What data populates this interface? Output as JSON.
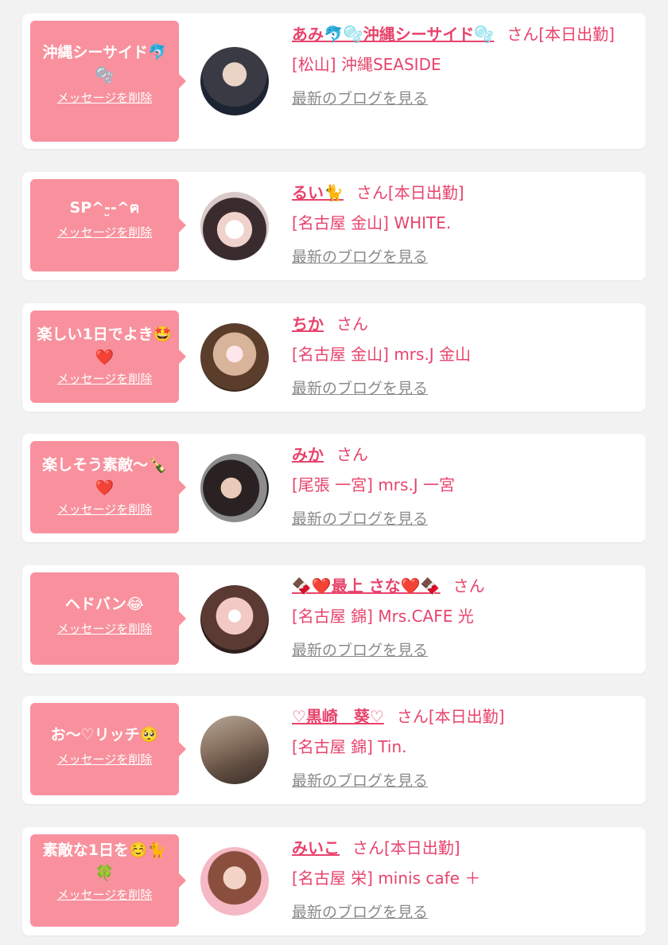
{
  "delete_label": "メッセージを削除",
  "blog_label": "最新のブログを見る",
  "colors": {
    "accent": "#e8436b",
    "bubble": "#f8919d",
    "link_gray": "#8a8a8a",
    "background": "#f2f2f3",
    "card": "#ffffff"
  },
  "items": [
    {
      "message": "沖縄シーサイド🐬🫧",
      "name": "あみ🐬🫧沖縄シーサイド🫧",
      "suffix": "さん[本日出勤]",
      "shop": "[松山] 沖縄SEASIDE",
      "avatar": "avatar-1"
    },
    {
      "message": "SP^-̮-^ฅ",
      "name": "るい🐈",
      "suffix": "さん[本日出勤]",
      "shop": "[名古屋 金山] WHITE.",
      "avatar": "avatar-2"
    },
    {
      "message": "楽しい1日でよき🤩❤️",
      "name": "ちか",
      "suffix": "さん",
      "shop": "[名古屋 金山] mrs.J 金山",
      "avatar": "avatar-3"
    },
    {
      "message": "楽しそう素敵〜🍾❤️",
      "name": "みか",
      "suffix": "さん",
      "shop": "[尾張 一宮] mrs.J 一宮",
      "avatar": "avatar-4"
    },
    {
      "message": "ヘドバン😂",
      "name": "🍫❤️最上 さな❤️🍫",
      "suffix": "さん",
      "shop": "[名古屋 錦] Mrs.CAFE 光",
      "avatar": "avatar-5"
    },
    {
      "message": "お〜♡リッチ🥺",
      "name": "♡黒崎　葵♡",
      "suffix": "さん[本日出勤]",
      "shop": "[名古屋 錦] Tin.",
      "avatar": "avatar-6"
    },
    {
      "message": "素敵な1日を☺️🐈🍀",
      "name": "みいこ",
      "suffix": "さん[本日出勤]",
      "shop": "[名古屋 栄] minis cafe ＋",
      "avatar": "avatar-7"
    }
  ]
}
